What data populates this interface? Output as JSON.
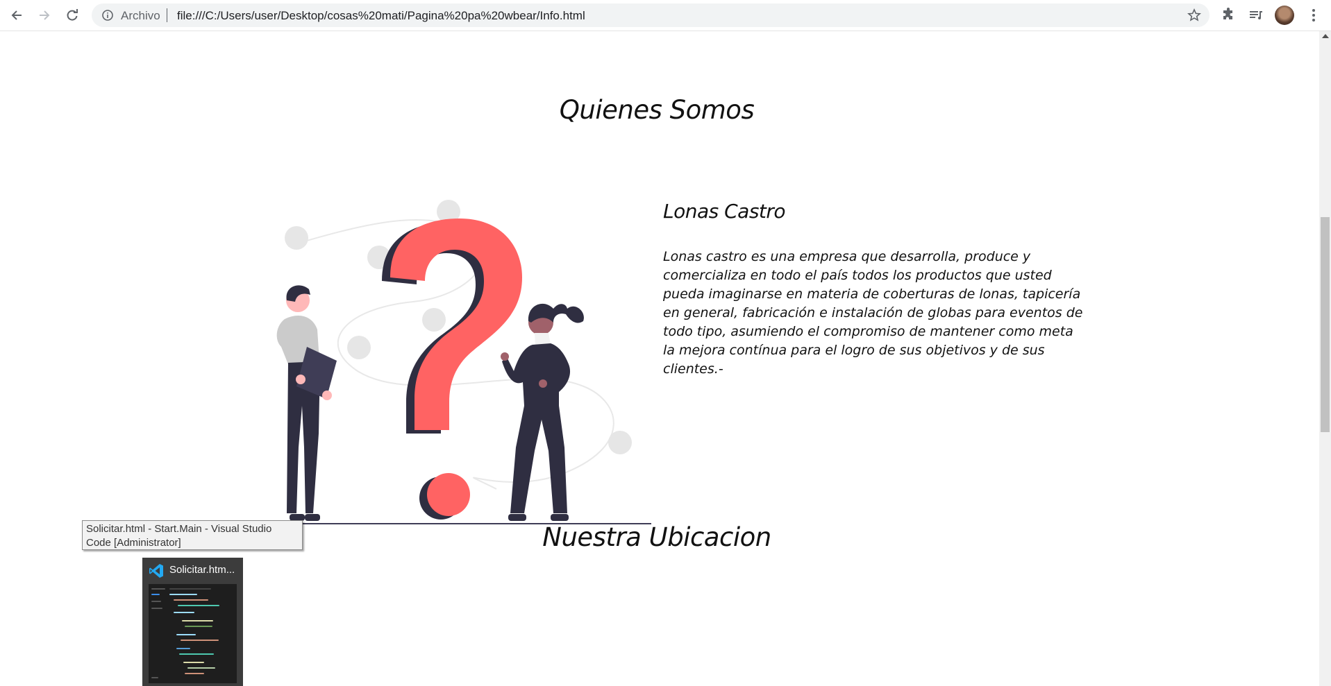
{
  "browser": {
    "scheme_label": "Archivo",
    "url": "file:///C:/Users/user/Desktop/cosas%20mati/Pagina%20pa%20wbear/Info.html",
    "icons": [
      "back-icon",
      "forward-icon",
      "reload-icon",
      "info-icon",
      "star-icon",
      "extensions-icon",
      "media-icon",
      "avatar",
      "menu-icon"
    ]
  },
  "page": {
    "section1_title": "Quienes Somos",
    "company_title": "Lonas Castro",
    "company_description": "Lonas castro es una empresa que desarrolla, produce y comercializa en todo el país todos los productos que usted pueda imaginarse en materia de coberturas de lonas, tapicería en general, fabricación e instalación de globas para eventos de todo tipo, asumiendo el compromiso de mantener como meta la mejora contínua para el logro de sus objetivos y de sus clientes.-",
    "section2_title": "Nuestra Ubicacion",
    "illustration": "question-mark-illustration"
  },
  "taskbar": {
    "tooltip": "Solicitar.html - Start.Main - Visual Studio Code [Administrator]",
    "thumbnail_title": "Solicitar.htm...",
    "thumbnail_app": "vscode-icon"
  },
  "colors": {
    "accent": "#ff6363",
    "dark": "#2f2e41",
    "chrome_bg": "#f1f3f4"
  }
}
